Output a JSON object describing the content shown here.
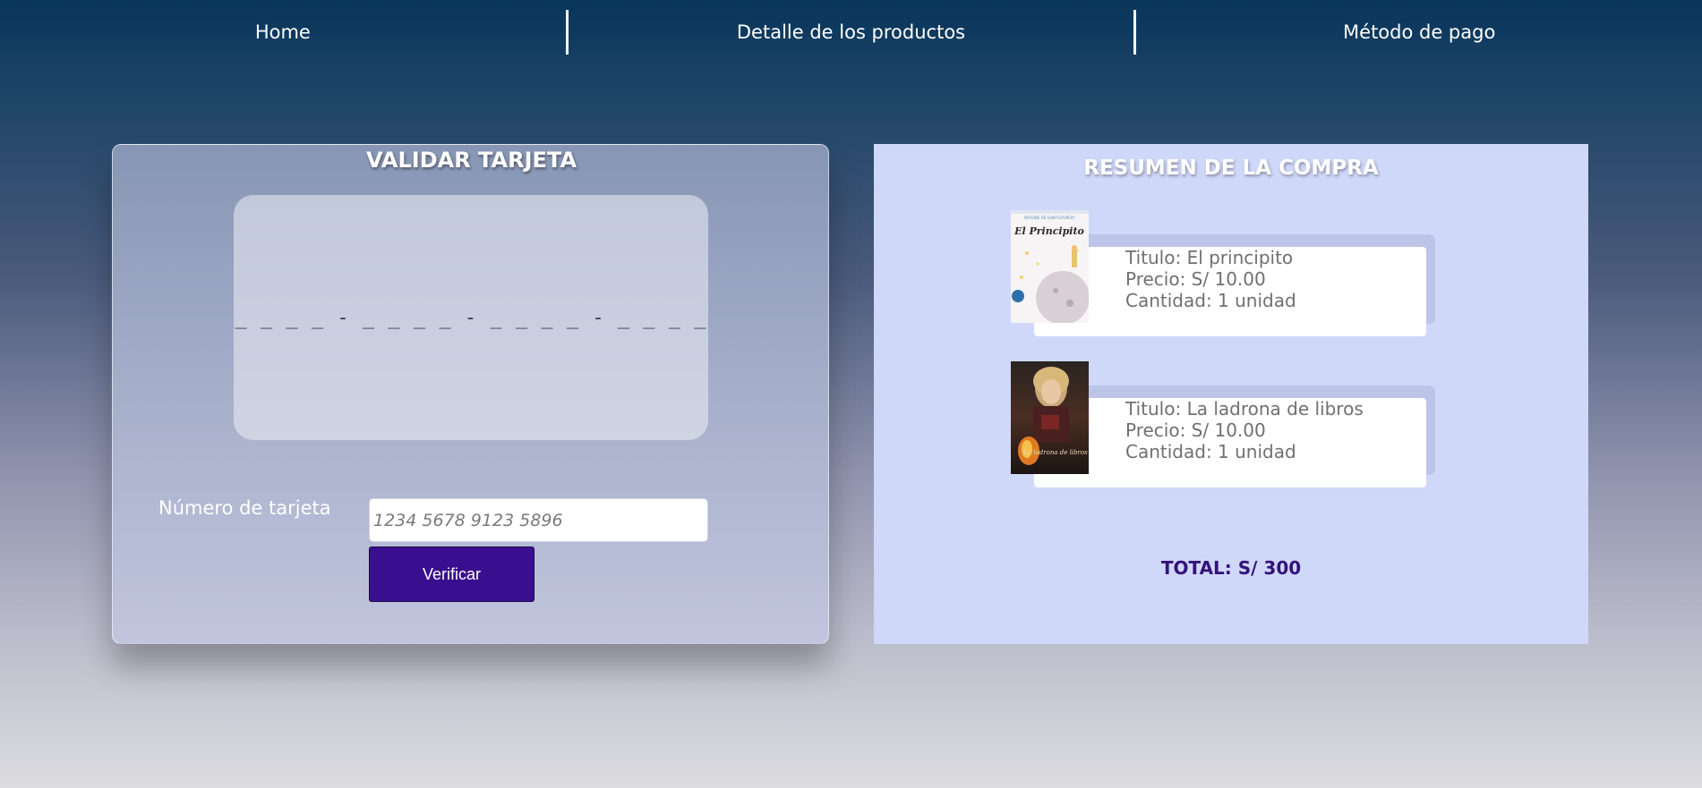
{
  "nav": {
    "items": [
      {
        "label": "Home"
      },
      {
        "label": "Detalle de los productos"
      },
      {
        "label": "Método de pago"
      }
    ]
  },
  "card_panel": {
    "title": "VALIDAR TARJETA",
    "preview_digits": "_ _ _ _ - _ _ _ _ - _ _ _ _ - _ _ _ _",
    "card_number_label": "Número de tarjeta",
    "card_number_value": "",
    "card_number_placeholder": "1234 5678 9123 5896",
    "verify_button": "Verificar"
  },
  "summary": {
    "title": "RESUMEN DE LA COMPRA",
    "products": [
      {
        "title": "Titulo: El principito",
        "price": "Precio: S/ 10.00",
        "quantity": "Cantidad: 1 unidad",
        "cover_text_top": "ANTOINE DE SAINT-EXUPÉRY",
        "cover_text_title": "El Principito"
      },
      {
        "title": "Titulo: La ladrona de libros",
        "price": "Precio: S/ 10.00",
        "quantity": "Cantidad: 1 unidad",
        "cover_text_title": "La ladrona de libros"
      }
    ],
    "total": "TOTAL: S/ 300"
  },
  "colors": {
    "accent_button": "#3a0f8f",
    "summary_bg": "#d0d8fa",
    "total_text": "#33137a"
  }
}
